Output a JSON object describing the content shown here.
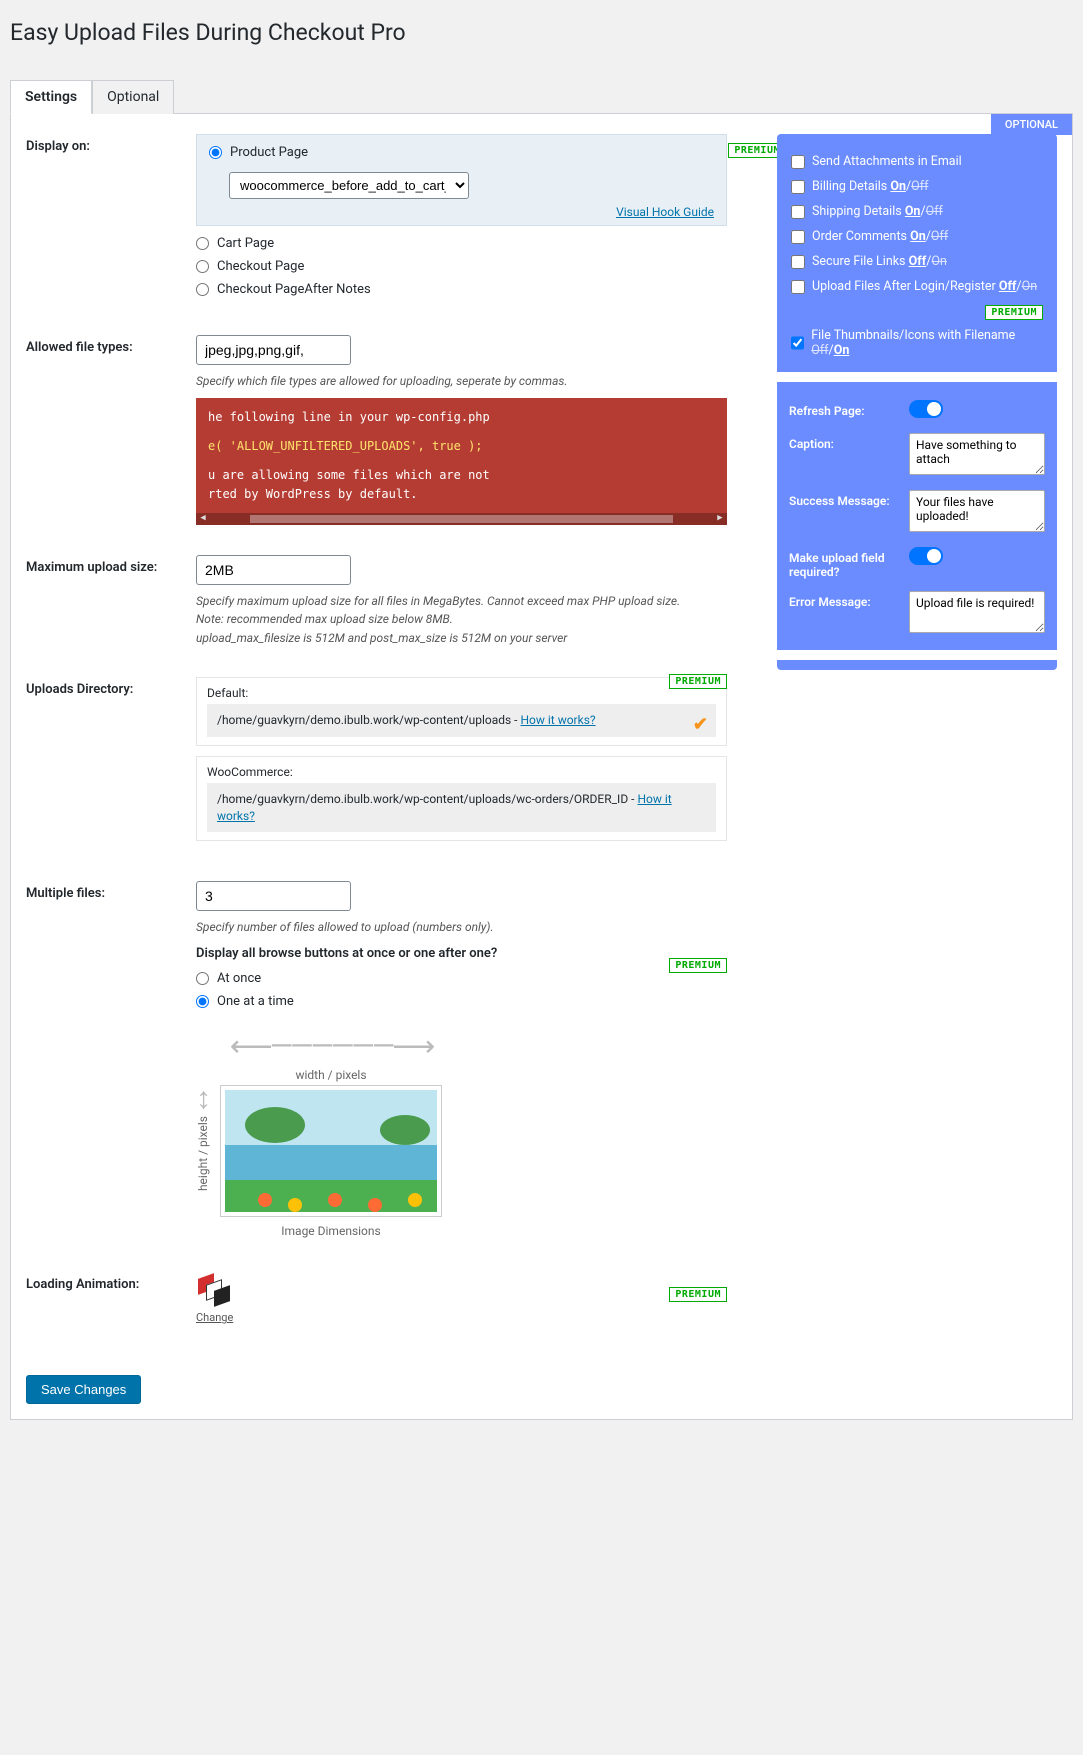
{
  "title": "Easy Upload Files During Checkout Pro",
  "tabs": {
    "settings": "Settings",
    "optional": "Optional"
  },
  "displayOn": {
    "label": "Display on:",
    "productPage": "Product Page",
    "hookSelect": "woocommerce_before_add_to_cart_button",
    "visualHook": "Visual Hook Guide",
    "cartPage": "Cart Page",
    "checkoutPage": "Checkout Page",
    "checkoutAfter": "Checkout PageAfter Notes",
    "premium": "PREMIUM"
  },
  "allowedTypes": {
    "label": "Allowed file types:",
    "value": "jpeg,jpg,png,gif,",
    "hint": "Specify which file types are allowed for uploading, seperate by commas.",
    "codeLine1": "he following line in your wp-config.php",
    "codeLine2": "e( 'ALLOW_UNFILTERED_UPLOADS', true );",
    "codeLine3": "u are allowing some files which are not",
    "codeLine4": "rted by WordPress by default."
  },
  "maxUpload": {
    "label": "Maximum upload size:",
    "value": "2MB",
    "hint1": "Specify maximum upload size for all files in MegaBytes. Cannot exceed max PHP upload size.",
    "hint2": "Note: recommended max upload size below 8MB.",
    "hint3": "upload_max_filesize is 512M and post_max_size is 512M on your server"
  },
  "uploadsDir": {
    "label": "Uploads Directory:",
    "premium": "PREMIUM",
    "defaultLabel": "Default:",
    "defaultPath": "/home/guavkyrn/demo.ibulb.work/wp-content/uploads - ",
    "howItWorks": "How it works?",
    "wcLabel": "WooCommerce:",
    "wcPath": "/home/guavkyrn/demo.ibulb.work/wp-content/uploads/wc-orders/ORDER_ID - "
  },
  "multipleFiles": {
    "label": "Multiple files:",
    "value": "3",
    "hint": "Specify number of files allowed to upload (numbers only).",
    "question": "Display all browse buttons at once or one after one?",
    "premium": "PREMIUM",
    "atOnce": "At once",
    "oneAtTime": "One at a time"
  },
  "imageDim": {
    "widthLabel": "width / pixels",
    "heightLabel": "height / pixels",
    "caption": "Image Dimensions"
  },
  "loadingAnim": {
    "label": "Loading Animation:",
    "change": "Change",
    "premium": "PREMIUM"
  },
  "saveBtn": "Save Changes",
  "optional": {
    "corner": "OPTIONAL",
    "sendEmail": "Send Attachments in Email",
    "billing": "Billing Details ",
    "shipping": "Shipping Details ",
    "orderComments": "Order Comments ",
    "secureLinks": "Secure File Links ",
    "uploadAfterLogin": "Upload Files After Login/Register ",
    "thumbnails": "File Thumbnails/Icons with Filename ",
    "on": "On",
    "off": "Off",
    "premium": "PREMIUM",
    "refreshPage": "Refresh Page:",
    "caption": "Caption:",
    "captionVal": "Have something to attach",
    "successMsg": "Success Message:",
    "successVal": "Your files have uploaded!",
    "requiredQ": "Make upload field required?",
    "errorMsg": "Error Message:",
    "errorVal": "Upload file is required!"
  }
}
